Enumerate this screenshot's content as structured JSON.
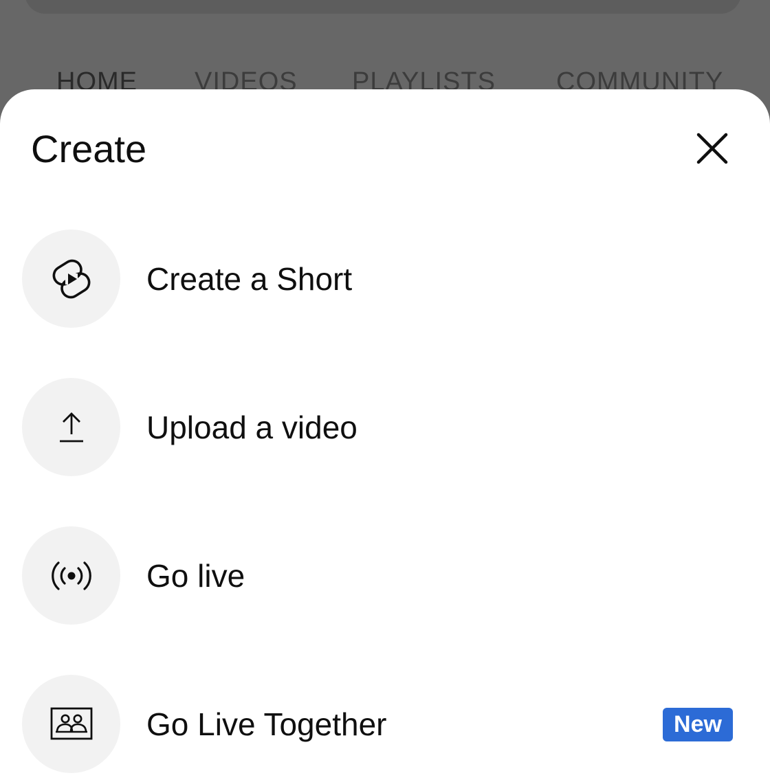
{
  "background": {
    "tabs": [
      {
        "label": "HOME"
      },
      {
        "label": "VIDEOS"
      },
      {
        "label": "PLAYLISTS"
      },
      {
        "label": "COMMUNITY"
      }
    ]
  },
  "sheet": {
    "title": "Create",
    "close_icon": "close-icon",
    "options": [
      {
        "label": "Create a Short",
        "icon": "shorts-icon"
      },
      {
        "label": "Upload a video",
        "icon": "upload-icon"
      },
      {
        "label": "Go live",
        "icon": "live-icon"
      },
      {
        "label": "Go Live Together",
        "icon": "go-live-together-icon",
        "badge": "New"
      }
    ]
  },
  "colors": {
    "overlay": "#676767",
    "sheet": "#ffffff",
    "icon_circle": "#f2f2f2",
    "badge": "#2c6bd6",
    "text": "#0f0f0f"
  }
}
